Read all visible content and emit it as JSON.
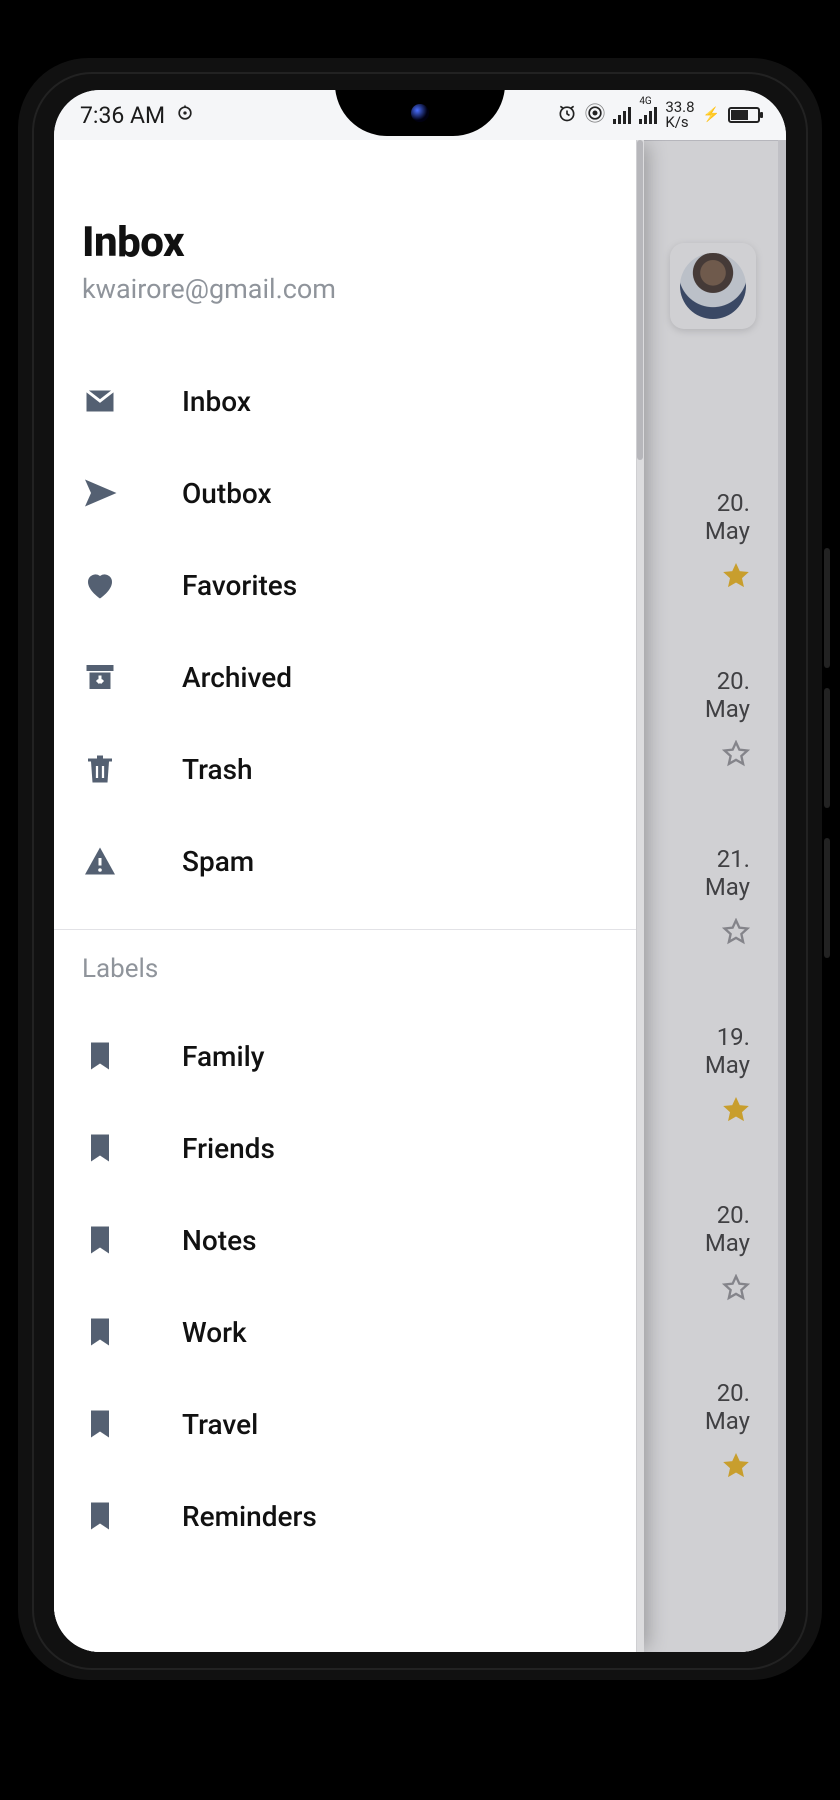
{
  "status_bar": {
    "time": "7:36 AM",
    "net_rate_top": "33.8",
    "net_rate_bottom": "K/s",
    "net_type": "4G"
  },
  "drawer": {
    "title": "Inbox",
    "account": "kwairore@gmail.com",
    "items": [
      {
        "icon": "mail",
        "label": "Inbox"
      },
      {
        "icon": "send",
        "label": "Outbox"
      },
      {
        "icon": "heart",
        "label": "Favorites"
      },
      {
        "icon": "archive",
        "label": "Archived"
      },
      {
        "icon": "trash",
        "label": "Trash"
      },
      {
        "icon": "warn",
        "label": "Spam"
      }
    ],
    "labels_section_title": "Labels",
    "labels": [
      {
        "label": "Family"
      },
      {
        "label": "Friends"
      },
      {
        "label": "Notes"
      },
      {
        "label": "Work"
      },
      {
        "label": "Travel"
      },
      {
        "label": "Reminders"
      }
    ]
  },
  "preview": {
    "rows": [
      {
        "date_top": "20.",
        "date_bottom": "May",
        "starred": true
      },
      {
        "date_top": "20.",
        "date_bottom": "May",
        "starred": false
      },
      {
        "date_top": "21.",
        "date_bottom": "May",
        "starred": false
      },
      {
        "date_top": "19.",
        "date_bottom": "May",
        "starred": true
      },
      {
        "date_top": "20.",
        "date_bottom": "May",
        "starred": false
      },
      {
        "date_top": "20.",
        "date_bottom": "May",
        "starred": true
      }
    ]
  }
}
